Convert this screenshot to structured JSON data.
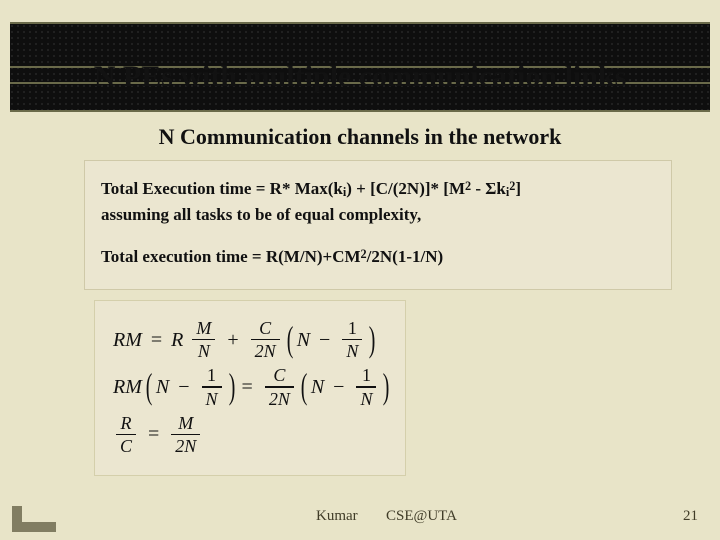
{
  "slide": {
    "title": "N PEs with multiple communication links",
    "subtitle": "N Communication channels in the network"
  },
  "box": {
    "line1a": "Total Execution time = R* Max(k",
    "line1_sub1": "i",
    "line1b": ") + [C/(2N)]* [M",
    "line1_sup1": "2",
    "line1c": " - Σk",
    "line1_sub2": "i",
    "line1_sup2": "2",
    "line1d": "]",
    "line2": "assuming all tasks to be of equal complexity,",
    "line3a": "Total execution time  = R(M/N)+CM",
    "line3_sup": "2",
    "line3b": "/2N(1-1/N)"
  },
  "eq": {
    "RM": "RM",
    "R": "R",
    "M": "M",
    "N": "N",
    "C": "C",
    "eq": "=",
    "plus": "+",
    "minus": "−",
    "one": "1",
    "two": "2",
    "twoN": "2N"
  },
  "footer": {
    "author": "Kumar",
    "course": "CSE@UTA",
    "page": "21"
  }
}
